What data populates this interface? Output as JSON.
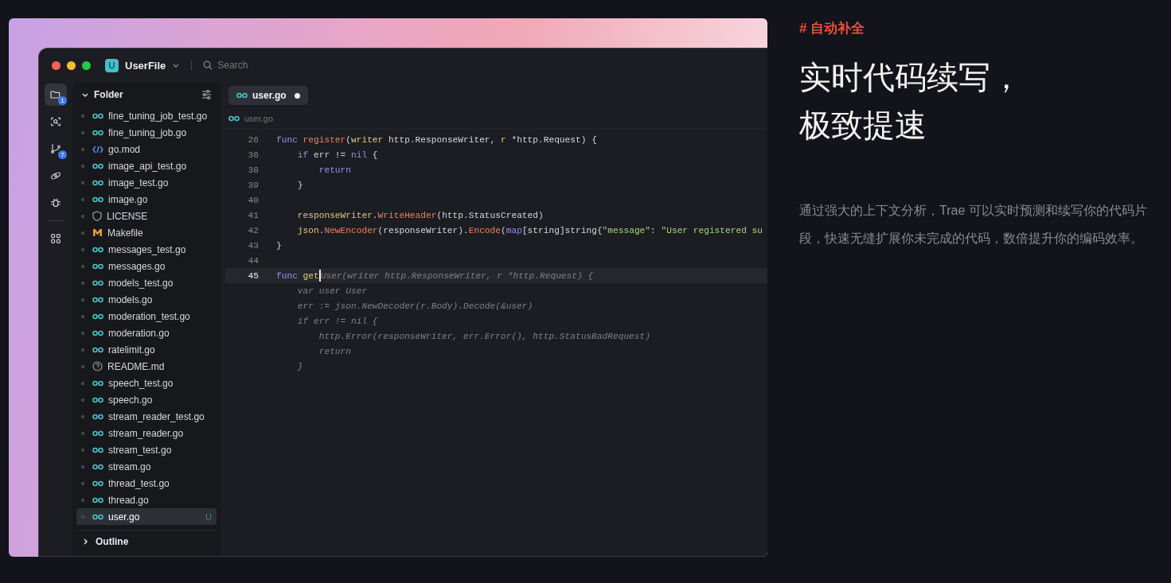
{
  "window": {
    "project_badge": "U",
    "project": "UserFile",
    "search": {
      "placeholder": "Search"
    }
  },
  "activity_bar": [
    {
      "kind": "files",
      "badge": "1",
      "selected": true
    },
    {
      "kind": "search",
      "selected": false
    },
    {
      "kind": "git",
      "badge": "7",
      "selected": false
    },
    {
      "kind": "link",
      "selected": false
    },
    {
      "kind": "bug",
      "selected": false
    },
    {
      "kind": "grid",
      "selected": false
    }
  ],
  "sidebar": {
    "title": "Folder",
    "outline": "Outline",
    "files": [
      {
        "name": "fine_tuning_job_test.go",
        "kind": "go",
        "selected": false
      },
      {
        "name": "fine_tuning_job.go",
        "kind": "go",
        "selected": false
      },
      {
        "name": "go.mod",
        "kind": "mod",
        "selected": false
      },
      {
        "name": "image_api_test.go",
        "kind": "go",
        "selected": false
      },
      {
        "name": "image_test.go",
        "kind": "go",
        "selected": false
      },
      {
        "name": "image.go",
        "kind": "go",
        "selected": false
      },
      {
        "name": "LICENSE",
        "kind": "license",
        "selected": false
      },
      {
        "name": "Makefile",
        "kind": "make",
        "selected": false
      },
      {
        "name": "messages_test.go",
        "kind": "go",
        "selected": false
      },
      {
        "name": "messages.go",
        "kind": "go",
        "selected": false
      },
      {
        "name": "models_test.go",
        "kind": "go",
        "selected": false
      },
      {
        "name": "models.go",
        "kind": "go",
        "selected": false
      },
      {
        "name": "moderation_test.go",
        "kind": "go",
        "selected": false
      },
      {
        "name": "moderation.go",
        "kind": "go",
        "selected": false
      },
      {
        "name": "ratelimit.go",
        "kind": "go",
        "selected": false
      },
      {
        "name": "README.md",
        "kind": "readme",
        "selected": false
      },
      {
        "name": "speech_test.go",
        "kind": "go",
        "selected": false
      },
      {
        "name": "speech.go",
        "kind": "go",
        "selected": false
      },
      {
        "name": "stream_reader_test.go",
        "kind": "go",
        "selected": false
      },
      {
        "name": "stream_reader.go",
        "kind": "go",
        "selected": false
      },
      {
        "name": "stream_test.go",
        "kind": "go",
        "selected": false
      },
      {
        "name": "stream.go",
        "kind": "go",
        "selected": false
      },
      {
        "name": "thread_test.go",
        "kind": "go",
        "selected": false
      },
      {
        "name": "thread.go",
        "kind": "go",
        "selected": false
      },
      {
        "name": "user.go",
        "kind": "go",
        "selected": true,
        "status": "U"
      }
    ]
  },
  "editor": {
    "tabs": [
      {
        "label": "user.go",
        "selected": true,
        "modified": true
      }
    ],
    "breadcrumb": "user.go",
    "lines": [
      {
        "number": "26",
        "current": false,
        "segments": [
          {
            "text": "func ",
            "kind": "keyword"
          },
          {
            "text": "register",
            "kind": "function"
          },
          {
            "text": "(",
            "kind": "plain"
          },
          {
            "text": "writer",
            "kind": "variable"
          },
          {
            "text": " http.ResponseWriter, ",
            "kind": "plain"
          },
          {
            "text": "r",
            "kind": "variable"
          },
          {
            "text": " *http.Request) {",
            "kind": "plain"
          }
        ]
      },
      {
        "number": "36",
        "current": false,
        "segments": [
          {
            "text": "    if ",
            "kind": "keyword"
          },
          {
            "text": "err != ",
            "kind": "plain"
          },
          {
            "text": "nil",
            "kind": "keyword"
          },
          {
            "text": " {",
            "kind": "plain"
          }
        ]
      },
      {
        "number": "38",
        "current": false,
        "segments": [
          {
            "text": "        return",
            "kind": "keyword"
          }
        ]
      },
      {
        "number": "39",
        "current": false,
        "segments": [
          {
            "text": "    }",
            "kind": "plain"
          }
        ]
      },
      {
        "number": "40",
        "current": false
      },
      {
        "number": "41",
        "current": false,
        "segments": [
          {
            "text": "    responseWriter",
            "kind": "variable"
          },
          {
            "text": ".",
            "kind": "plain"
          },
          {
            "text": "WriteHeader",
            "kind": "function"
          },
          {
            "text": "(http.StatusCreated)",
            "kind": "plain"
          }
        ]
      },
      {
        "number": "42",
        "current": false,
        "segments": [
          {
            "text": "    json",
            "kind": "variable"
          },
          {
            "text": ".",
            "kind": "plain"
          },
          {
            "text": "NewEncoder",
            "kind": "function"
          },
          {
            "text": "(responseWriter).",
            "kind": "plain"
          },
          {
            "text": "Encode",
            "kind": "function"
          },
          {
            "text": "(",
            "kind": "plain"
          },
          {
            "text": "map",
            "kind": "keyword"
          },
          {
            "text": "[string]string{",
            "kind": "plain"
          },
          {
            "text": "\"message\"",
            "kind": "string"
          },
          {
            "text": ": ",
            "kind": "plain"
          },
          {
            "text": "\"User registered su",
            "kind": "string"
          }
        ]
      },
      {
        "number": "43",
        "current": false,
        "segments": [
          {
            "text": "}",
            "kind": "plain"
          }
        ]
      },
      {
        "number": "44",
        "current": false
      },
      {
        "number": "45",
        "current": true,
        "segments": [
          {
            "text": "func ",
            "kind": "keyword"
          },
          {
            "text": "get",
            "kind": "variable",
            "cursor": true
          },
          {
            "text": "User(writer http.ResponseWriter, r *http.Request) {",
            "kind": "ghost"
          }
        ]
      },
      {
        "segments": [
          {
            "text": "    var user User",
            "kind": "ghost"
          }
        ]
      },
      {
        "segments": [
          {
            "text": "    err := json.NewDecoder(r.Body).Decode(&user)",
            "kind": "ghost"
          }
        ]
      },
      {
        "segments": [
          {
            "text": "    if err != nil {",
            "kind": "ghost"
          }
        ]
      },
      {
        "segments": [
          {
            "text": "        http.Error(responseWriter, err.Error(), http.StatusBadRequest)",
            "kind": "ghost"
          }
        ]
      },
      {
        "segments": [
          {
            "text": "        return",
            "kind": "ghost"
          }
        ]
      },
      {
        "segments": [
          {
            "text": "    }",
            "kind": "ghost"
          }
        ]
      }
    ]
  },
  "feature": {
    "tag": "# 自动补全",
    "heading": [
      "实时代码续写，",
      "极致提速"
    ],
    "description": "通过强大的上下文分析，Trae 可以实时预测和续写你的代码片段，快速无缝扩展你未完成的代码，数倍提升你的编码效率。"
  }
}
